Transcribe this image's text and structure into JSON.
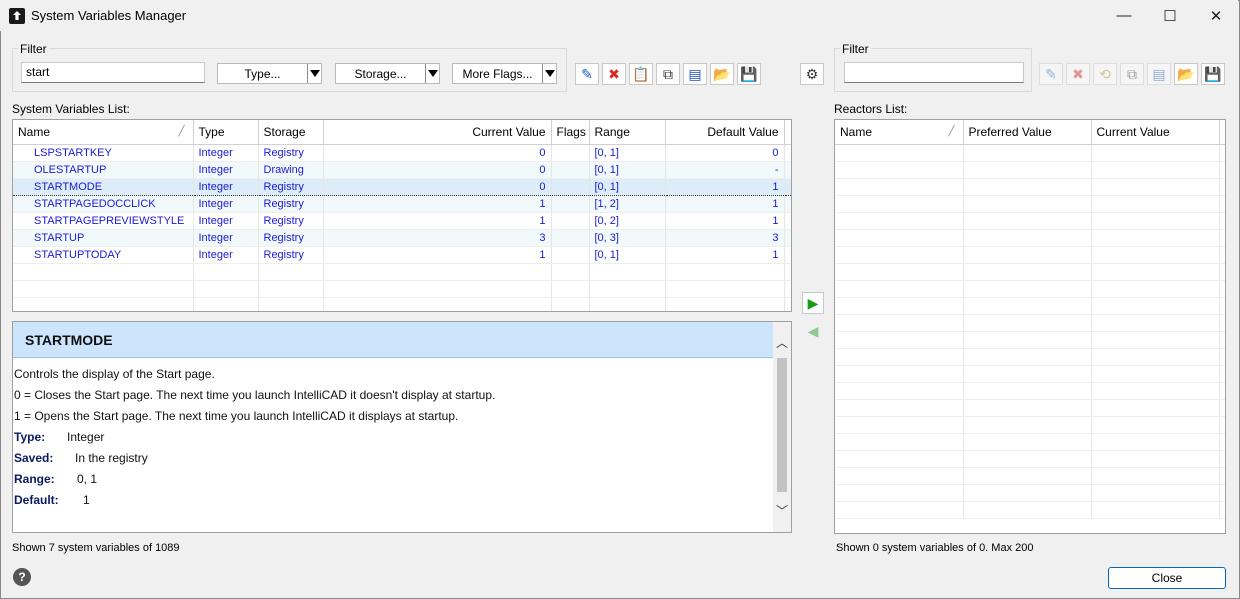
{
  "window": {
    "title": "System Variables Manager",
    "minimize_glyph": "—",
    "maximize_glyph": "☐",
    "close_glyph": "✕"
  },
  "left_filter": {
    "label": "Filter",
    "value": "start",
    "type_label": "Type...",
    "storage_label": "Storage...",
    "flags_label": "More Flags..."
  },
  "toolbar_left": [
    {
      "name": "edit-icon",
      "glyph": "✎",
      "color": "#1f5fbf"
    },
    {
      "name": "delete-icon",
      "glyph": "✖",
      "color": "#d42b1e"
    },
    {
      "name": "paste-icon",
      "glyph": "📋",
      "color": "#b58a2a"
    },
    {
      "name": "copy-icon",
      "glyph": "⧉",
      "color": "#333"
    },
    {
      "name": "properties-icon",
      "glyph": "▤",
      "color": "#1f4fbf"
    },
    {
      "name": "open-folder-icon",
      "glyph": "📂",
      "color": "#d7a32a"
    },
    {
      "name": "save-icon",
      "glyph": "💾",
      "color": "#5b2b86"
    }
  ],
  "settings_glyph": "⚙",
  "system_list": {
    "label": "System Variables List:",
    "columns": [
      "Name",
      "Type",
      "Storage",
      "Current Value",
      "Flags",
      "Range",
      "Default Value"
    ],
    "rows": [
      {
        "name": "LSPSTARTKEY",
        "type": "Integer",
        "storage": "Registry",
        "current": "0",
        "flags": "",
        "range": "[0, 1]",
        "default": "0"
      },
      {
        "name": "OLESTARTUP",
        "type": "Integer",
        "storage": "Drawing",
        "current": "0",
        "flags": "",
        "range": "[0, 1]",
        "default": "-"
      },
      {
        "name": "STARTMODE",
        "type": "Integer",
        "storage": "Registry",
        "current": "0",
        "flags": "",
        "range": "[0, 1]",
        "default": "1"
      },
      {
        "name": "STARTPAGEDOCCLICK",
        "type": "Integer",
        "storage": "Registry",
        "current": "1",
        "flags": "",
        "range": "[1, 2]",
        "default": "1"
      },
      {
        "name": "STARTPAGEPREVIEWSTYLE",
        "type": "Integer",
        "storage": "Registry",
        "current": "1",
        "flags": "",
        "range": "[0, 2]",
        "default": "1"
      },
      {
        "name": "STARTUP",
        "type": "Integer",
        "storage": "Registry",
        "current": "3",
        "flags": "",
        "range": "[0, 3]",
        "default": "3"
      },
      {
        "name": "STARTUPTODAY",
        "type": "Integer",
        "storage": "Registry",
        "current": "1",
        "flags": "",
        "range": "[0, 1]",
        "default": "1"
      }
    ],
    "selected_index": 2
  },
  "description": {
    "title": "STARTMODE",
    "lines": [
      "Controls the display of the Start page.",
      "0 = Closes the Start page. The next time you launch IntelliCAD it doesn't display at startup.",
      "1 = Opens the Start page. The next time you launch IntelliCAD it displays at startup."
    ],
    "type_key": "Type:",
    "type_val": "Integer",
    "saved_key": "Saved:",
    "saved_val": "In the registry",
    "range_key": "Range:",
    "range_val": "0, 1",
    "default_key": "Default:",
    "default_val": "1"
  },
  "transfer": {
    "add_glyph": "▶",
    "remove_glyph": "◀"
  },
  "right_filter": {
    "label": "Filter",
    "value": ""
  },
  "toolbar_right": [
    {
      "name": "edit-icon",
      "glyph": "✎",
      "color": "#1f5fbf",
      "disabled": true
    },
    {
      "name": "delete-icon",
      "glyph": "✖",
      "color": "#d42b1e",
      "disabled": true
    },
    {
      "name": "reset-icon",
      "glyph": "⟲",
      "color": "#b58a2a",
      "disabled": true
    },
    {
      "name": "copy-icon",
      "glyph": "⧉",
      "color": "#333",
      "disabled": true
    },
    {
      "name": "properties-icon",
      "glyph": "▤",
      "color": "#1f4fbf",
      "disabled": true
    },
    {
      "name": "open-folder-icon",
      "glyph": "📂",
      "color": "#d7a32a",
      "disabled": false
    },
    {
      "name": "save-icon",
      "glyph": "💾",
      "color": "#5b2b86",
      "disabled": false
    }
  ],
  "reactors_list": {
    "label": "Reactors List:",
    "columns": [
      "Name",
      "Preferred Value",
      "Current Value"
    ]
  },
  "status": {
    "left": "Shown 7 system variables of 1089",
    "right": "Shown 0 system variables of 0. Max 200"
  },
  "footer": {
    "help_glyph": "?",
    "close_label": "Close"
  }
}
